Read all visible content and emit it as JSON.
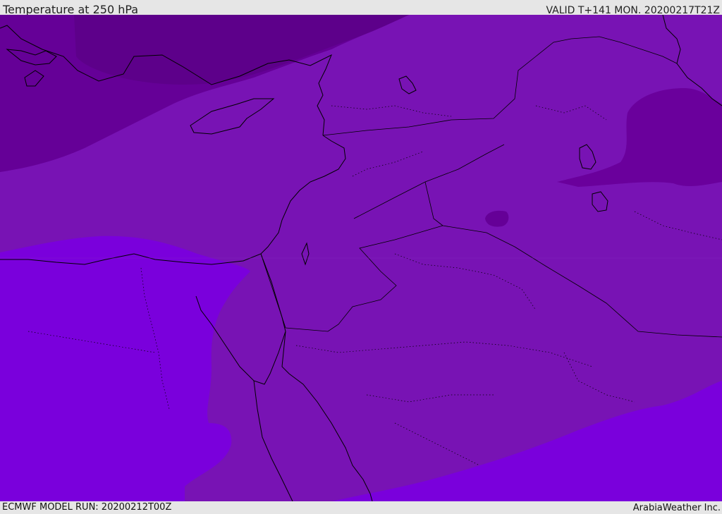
{
  "header": {
    "title": "Temperature at 250 hPa",
    "valid": "VALID T+141 MON. 20200217T21Z"
  },
  "footer": {
    "model_run": "ECMWF MODEL RUN: 20200212T00Z",
    "credit": "ArabiaWeather Inc."
  },
  "map": {
    "variable": "temperature",
    "level": "250 hPa",
    "region": "Eastern Mediterranean / Middle East",
    "shading_colors": {
      "coldest": "#650097",
      "cold": "#7b11b5",
      "mid": "#7314b6",
      "warm": "#7a00dc",
      "border_line": "#000000"
    }
  }
}
